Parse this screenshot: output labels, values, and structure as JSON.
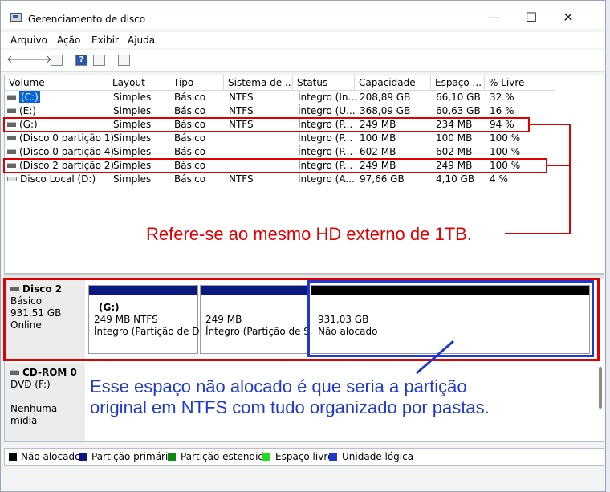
{
  "window": {
    "title": "Gerenciamento de disco",
    "minimize": "—",
    "maximize": "☐",
    "close": "✕"
  },
  "menu": [
    "Arquivo",
    "Ação",
    "Exibir",
    "Ajuda"
  ],
  "toolbar": {
    "back": "🡐",
    "forward": "🡒",
    "help": "?"
  },
  "volumes": {
    "headers": [
      "Volume",
      "Layout",
      "Tipo",
      "Sistema de ...",
      "Status",
      "Capacidade",
      "Espaço ...",
      "% Livre"
    ],
    "rows": [
      [
        "(C:)",
        "Simples",
        "Básico",
        "NTFS",
        "Íntegro (In...",
        "208,89 GB",
        "66,10 GB",
        "32 %"
      ],
      [
        "(E:)",
        "Simples",
        "Básico",
        "NTFS",
        "Íntegro (U...",
        "368,09 GB",
        "60,63 GB",
        "16 %"
      ],
      [
        "(G:)",
        "Simples",
        "Básico",
        "NTFS",
        "Íntegro (P...",
        "249 MB",
        "234 MB",
        "94 %"
      ],
      [
        "(Disco 0 partição 1)",
        "Simples",
        "Básico",
        "",
        "Íntegro (P...",
        "100 MB",
        "100 MB",
        "100 %"
      ],
      [
        "(Disco 0 partição 4)",
        "Simples",
        "Básico",
        "",
        "Íntegro (P...",
        "602 MB",
        "602 MB",
        "100 %"
      ],
      [
        "(Disco 2 partição 2)",
        "Simples",
        "Básico",
        "",
        "Íntegro (P...",
        "249 MB",
        "249 MB",
        "100 %"
      ],
      [
        "Disco Local (D:)",
        "Simples",
        "Básico",
        "NTFS",
        "Íntegro (A...",
        "97,66 GB",
        "4,10 GB",
        "4 %"
      ]
    ]
  },
  "annotations": {
    "red_note": "Refere-se ao mesmo HD externo de 1TB.",
    "blue_note_line1": "Esse espaço não alocado é que seria a partição",
    "blue_note_line2": "original em NTFS com tudo organizado por pastas.",
    "red_color": "#e00000",
    "blue_color": "#1f3ad0"
  },
  "disks": {
    "disk2": {
      "name": "Disco 2",
      "type": "Básico",
      "size": "931,51 GB",
      "status": "Online",
      "partitions": [
        {
          "label": "(G:)",
          "size": "249 MB NTFS",
          "status": "Íntegro (Partição de Da"
        },
        {
          "label": "",
          "size": "249 MB",
          "status": "Íntegro (Partição de Sist"
        },
        {
          "label": "",
          "size": "931,03 GB",
          "status": "Não alocado"
        }
      ]
    },
    "cdrom": {
      "name": "CD-ROM 0",
      "drive": "DVD (F:)",
      "media": "Nenhuma mídia"
    }
  },
  "legend": [
    {
      "label": "Não alocado",
      "color": "#000000"
    },
    {
      "label": "Partição primária",
      "color": "#0a1a80"
    },
    {
      "label": "Partição estendida",
      "color": "#0a8a10"
    },
    {
      "label": "Espaço livre",
      "color": "#22dd22"
    },
    {
      "label": "Unidade lógica",
      "color": "#1f3ad0"
    }
  ]
}
